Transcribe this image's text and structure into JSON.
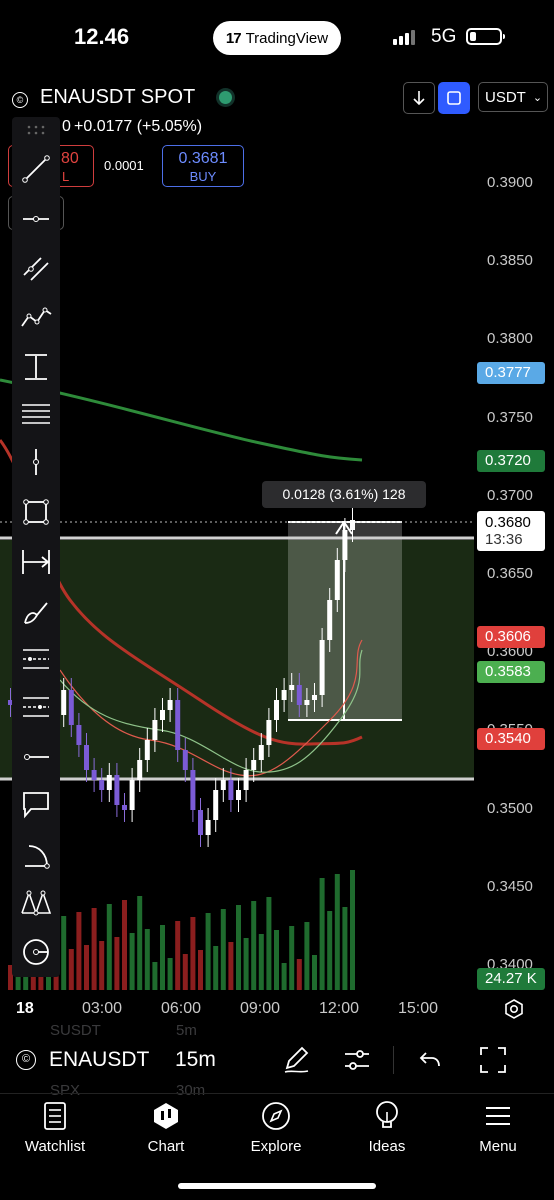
{
  "status_bar": {
    "time": "12.46",
    "app_pill": "TradingView",
    "network": "5G"
  },
  "header": {
    "symbol": "ENAUSDT SPOT",
    "change_text": "+0.0177 (+5.05%)",
    "price_prefix_fragment": "0",
    "sell_price": "80",
    "sell_label": "L",
    "spread": "0.0001",
    "buy_price": "0.3681",
    "buy_label": "BUY",
    "qty_fragment": "3",
    "currency": "USDT"
  },
  "price_axis": {
    "ticks": [
      "0.3900",
      "0.3850",
      "0.3800",
      "0.3750",
      "0.3700",
      "0.3650",
      "0.3600",
      "0.3550",
      "0.3500",
      "0.3450",
      "0.3400"
    ],
    "labels": [
      {
        "value": "0.3777",
        "color": "#5aa9e6"
      },
      {
        "value": "0.3720",
        "color": "#1f7a3a"
      },
      {
        "value": "0.3606",
        "color": "#e0403c"
      },
      {
        "value": "0.3583",
        "color": "#4caf50"
      },
      {
        "value": "0.3540",
        "color": "#e0403c"
      },
      {
        "value": "24.27 K",
        "color": "#1f7a3a"
      }
    ],
    "current_price": "0.3680",
    "countdown": "13:36"
  },
  "measure_label": "0.0128 (3.61%) 128",
  "time_axis": [
    "18",
    "03:00",
    "06:00",
    "09:00",
    "12:00",
    "15:00"
  ],
  "chart_data": {
    "type": "candlestick",
    "symbol": "ENAUSDT",
    "interval": "15m",
    "y_range": [
      0.338,
      0.392
    ],
    "x_range": [
      "18",
      "15:00"
    ],
    "last_price": 0.368,
    "horizontal_lines": [
      0.3672,
      0.3512
    ],
    "price_labels": [
      0.3777,
      0.372,
      0.3606,
      0.3583,
      0.354
    ],
    "volume_last": "24.27 K",
    "moving_averages": [
      {
        "color": "#2e8b3a",
        "approx_values": [
          0.3745,
          0.3732,
          0.372
        ]
      },
      {
        "color": "#c0392b",
        "approx_values": [
          0.365,
          0.3585,
          0.3545
        ]
      }
    ]
  },
  "bottom_bar": {
    "symbol": "ENAUSDT",
    "interval": "15m",
    "ghost_items": [
      "SUSDT",
      "5m",
      "SPX",
      "30m"
    ]
  },
  "nav": [
    {
      "label": "Watchlist",
      "icon": "watchlist-icon"
    },
    {
      "label": "Chart",
      "icon": "chart-icon"
    },
    {
      "label": "Explore",
      "icon": "compass-icon"
    },
    {
      "label": "Ideas",
      "icon": "lightbulb-icon"
    },
    {
      "label": "Menu",
      "icon": "hamburger-icon"
    }
  ]
}
